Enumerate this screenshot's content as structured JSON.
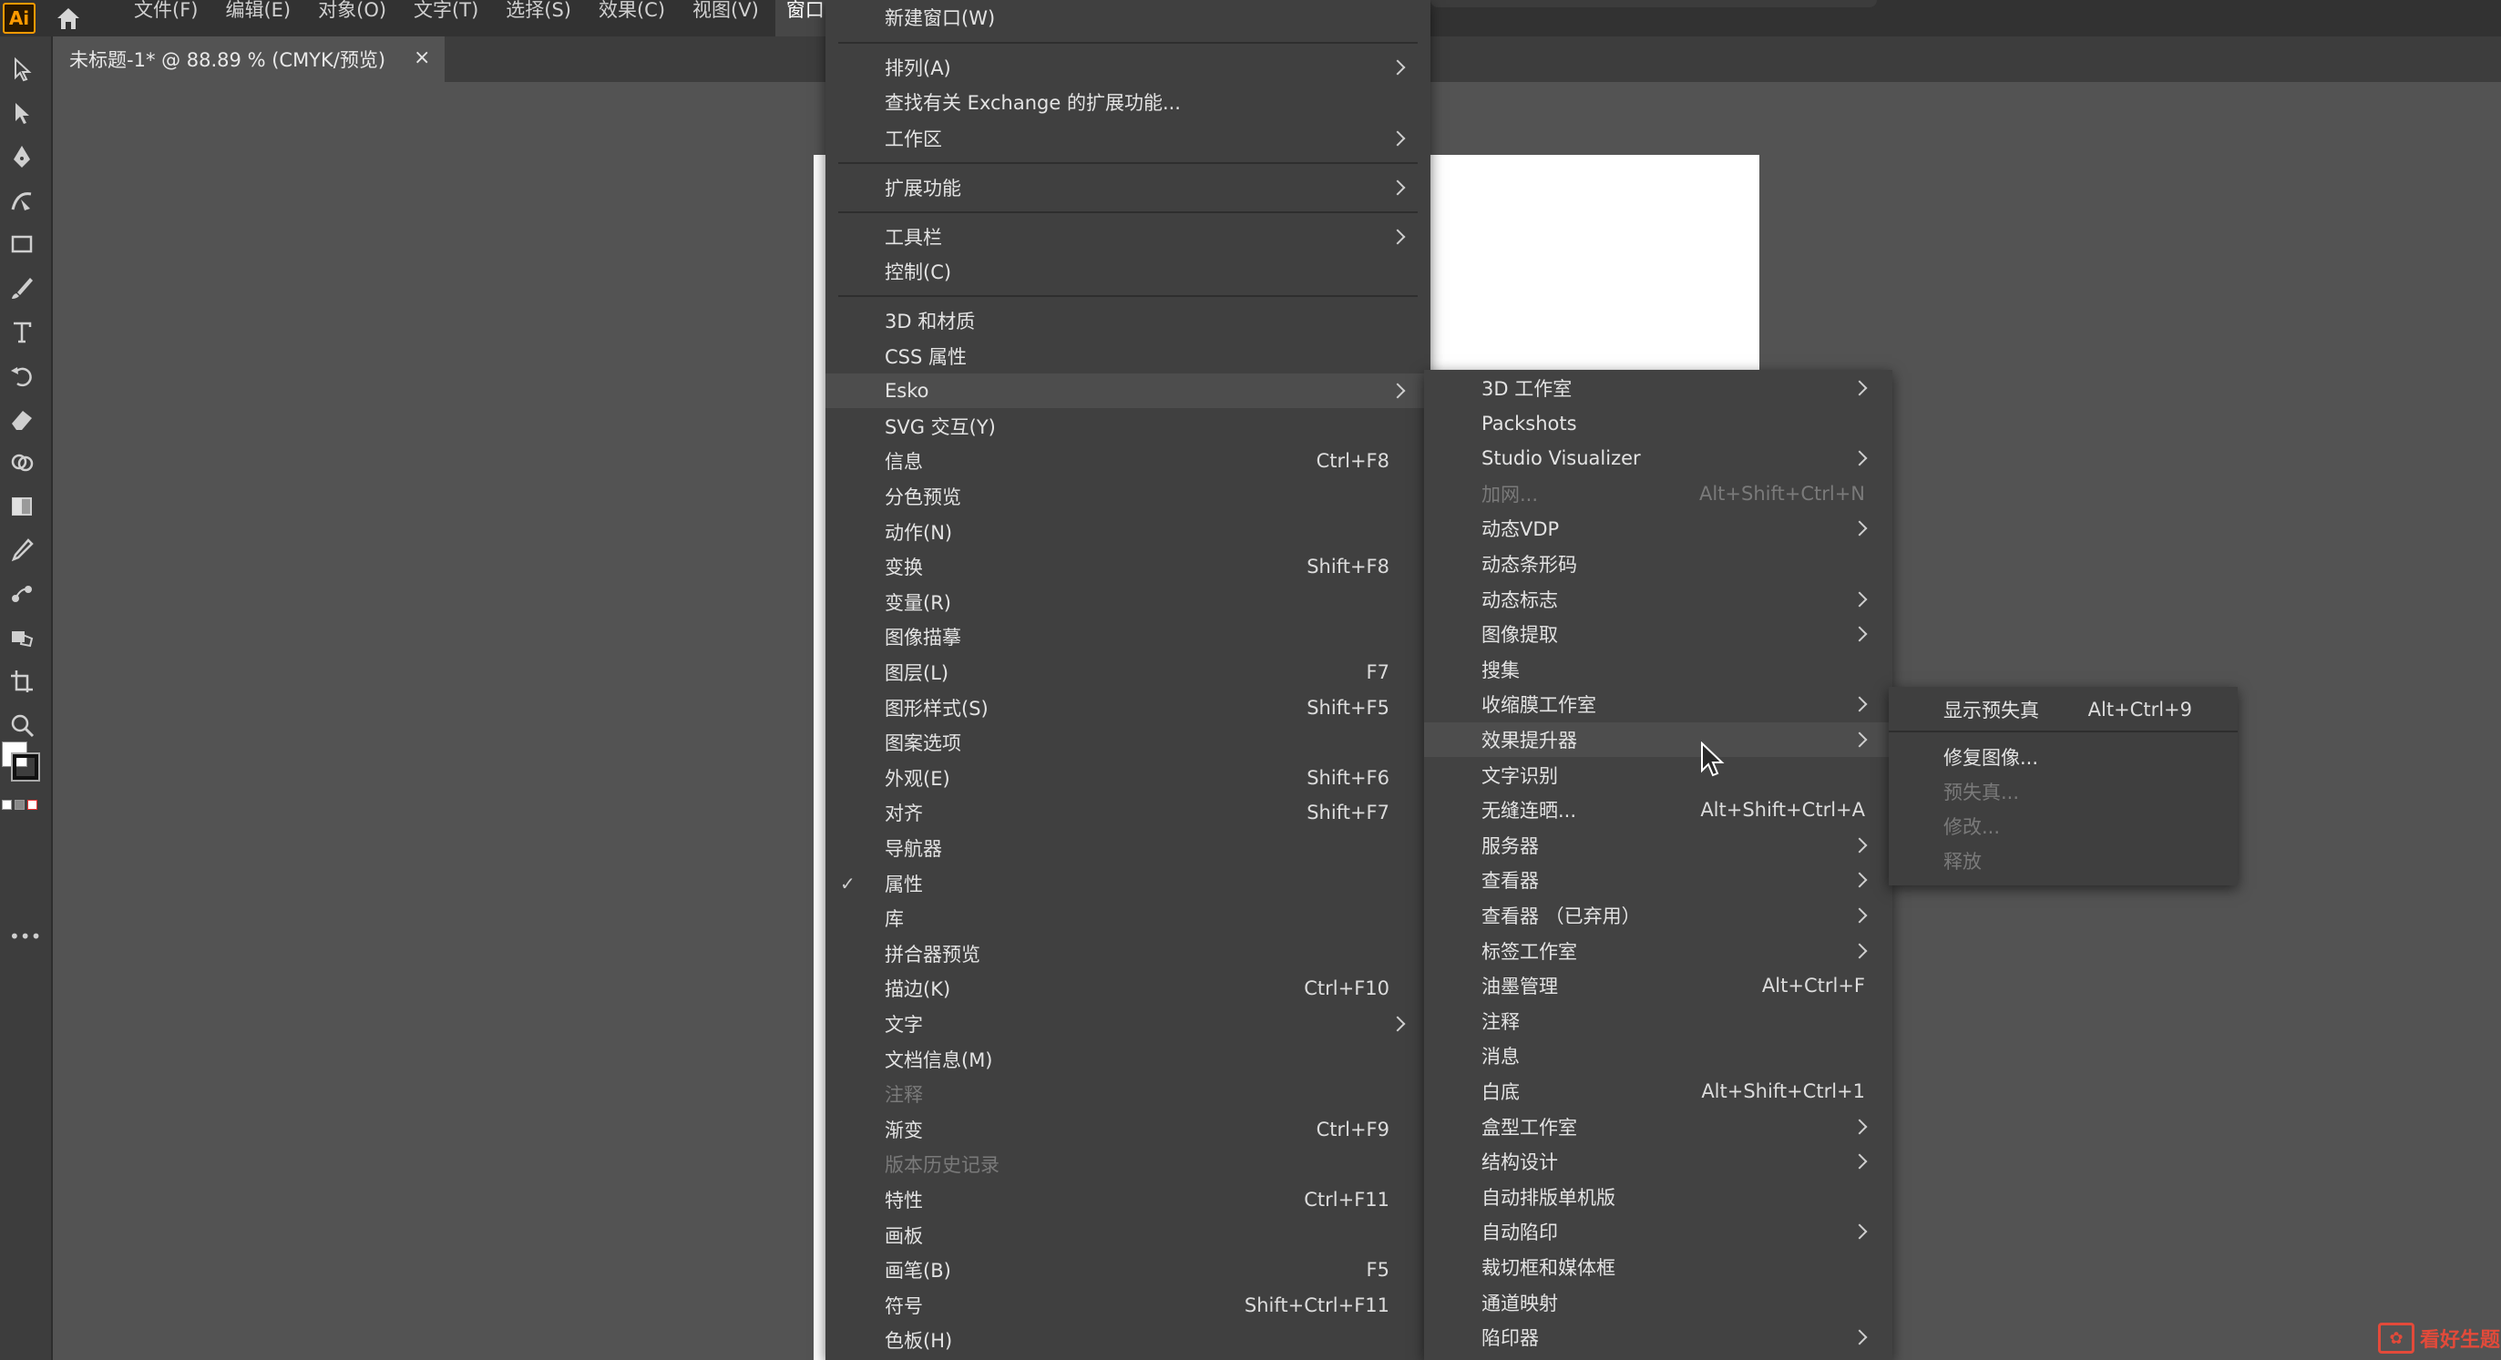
{
  "app": {
    "logo": "Ai",
    "home_icon": "home-icon"
  },
  "menubar": {
    "items": [
      "文件(F)",
      "编辑(E)",
      "对象(O)",
      "文字(T)",
      "选择(S)",
      "效果(C)",
      "视图(V)",
      "窗口(W)"
    ],
    "active_index": 7
  },
  "document_tab": {
    "title": "未标题-1* @ 88.89 % (CMYK/预览)",
    "close": "×"
  },
  "tools": [
    "selection-tool-icon",
    "direct-selection-tool-icon",
    "pen-tool-icon",
    "curvature-tool-icon",
    "rectangle-tool-icon",
    "paintbrush-tool-icon",
    "type-tool-icon",
    "rotate-tool-icon",
    "eraser-tool-icon",
    "shape-builder-tool-icon",
    "gradient-tool-icon",
    "eyedropper-tool-icon",
    "blend-tool-icon",
    "live-paint-tool-icon",
    "artboard-tool-icon",
    "zoom-tool-icon"
  ],
  "toolbar_more": "•••",
  "window_menu": {
    "items": [
      {
        "label": "新建窗口(W)",
        "shortcut": "",
        "submenu": false,
        "disabled": false
      },
      {
        "label": "排列(A)",
        "shortcut": "",
        "submenu": true,
        "disabled": false
      },
      {
        "label": "查找有关 Exchange 的扩展功能...",
        "shortcut": "",
        "submenu": false,
        "disabled": false
      },
      {
        "label": "工作区",
        "shortcut": "",
        "submenu": true,
        "disabled": false
      },
      {
        "label": "扩展功能",
        "shortcut": "",
        "submenu": true,
        "disabled": false
      },
      {
        "label": "工具栏",
        "shortcut": "",
        "submenu": true,
        "disabled": false
      },
      {
        "label": "控制(C)",
        "shortcut": "",
        "submenu": false,
        "disabled": false
      },
      {
        "label": "3D 和材质",
        "shortcut": "",
        "submenu": false,
        "disabled": false
      },
      {
        "label": "CSS 属性",
        "shortcut": "",
        "submenu": false,
        "disabled": false
      },
      {
        "label": "Esko",
        "shortcut": "",
        "submenu": true,
        "disabled": false,
        "highlighted": true
      },
      {
        "label": "SVG 交互(Y)",
        "shortcut": "",
        "submenu": false,
        "disabled": false
      },
      {
        "label": "信息",
        "shortcut": "Ctrl+F8",
        "submenu": false,
        "disabled": false
      },
      {
        "label": "分色预览",
        "shortcut": "",
        "submenu": false,
        "disabled": false
      },
      {
        "label": "动作(N)",
        "shortcut": "",
        "submenu": false,
        "disabled": false
      },
      {
        "label": "变换",
        "shortcut": "Shift+F8",
        "submenu": false,
        "disabled": false
      },
      {
        "label": "变量(R)",
        "shortcut": "",
        "submenu": false,
        "disabled": false
      },
      {
        "label": "图像描摹",
        "shortcut": "",
        "submenu": false,
        "disabled": false
      },
      {
        "label": "图层(L)",
        "shortcut": "F7",
        "submenu": false,
        "disabled": false
      },
      {
        "label": "图形样式(S)",
        "shortcut": "Shift+F5",
        "submenu": false,
        "disabled": false
      },
      {
        "label": "图案选项",
        "shortcut": "",
        "submenu": false,
        "disabled": false
      },
      {
        "label": "外观(E)",
        "shortcut": "Shift+F6",
        "submenu": false,
        "disabled": false
      },
      {
        "label": "对齐",
        "shortcut": "Shift+F7",
        "submenu": false,
        "disabled": false
      },
      {
        "label": "导航器",
        "shortcut": "",
        "submenu": false,
        "disabled": false
      },
      {
        "label": "属性",
        "shortcut": "",
        "submenu": false,
        "disabled": false,
        "checked": true
      },
      {
        "label": "库",
        "shortcut": "",
        "submenu": false,
        "disabled": false
      },
      {
        "label": "拼合器预览",
        "shortcut": "",
        "submenu": false,
        "disabled": false
      },
      {
        "label": "描边(K)",
        "shortcut": "Ctrl+F10",
        "submenu": false,
        "disabled": false
      },
      {
        "label": "文字",
        "shortcut": "",
        "submenu": true,
        "disabled": false
      },
      {
        "label": "文档信息(M)",
        "shortcut": "",
        "submenu": false,
        "disabled": false
      },
      {
        "label": "注释",
        "shortcut": "",
        "submenu": false,
        "disabled": true
      },
      {
        "label": "渐变",
        "shortcut": "Ctrl+F9",
        "submenu": false,
        "disabled": false
      },
      {
        "label": "版本历史记录",
        "shortcut": "",
        "submenu": false,
        "disabled": true
      },
      {
        "label": "特性",
        "shortcut": "Ctrl+F11",
        "submenu": false,
        "disabled": false
      },
      {
        "label": "画板",
        "shortcut": "",
        "submenu": false,
        "disabled": false
      },
      {
        "label": "画笔(B)",
        "shortcut": "F5",
        "submenu": false,
        "disabled": false
      },
      {
        "label": "符号",
        "shortcut": "Shift+Ctrl+F11",
        "submenu": false,
        "disabled": false
      },
      {
        "label": "色板(H)",
        "shortcut": "",
        "submenu": false,
        "disabled": false
      }
    ]
  },
  "esko_menu": {
    "items": [
      {
        "label": "3D 工作室",
        "shortcut": "",
        "submenu": true,
        "disabled": false
      },
      {
        "label": "Packshots",
        "shortcut": "",
        "submenu": false,
        "disabled": false
      },
      {
        "label": "Studio Visualizer",
        "shortcut": "",
        "submenu": true,
        "disabled": false
      },
      {
        "label": "加网...",
        "shortcut": "Alt+Shift+Ctrl+N",
        "submenu": false,
        "disabled": true
      },
      {
        "label": "动态VDP",
        "shortcut": "",
        "submenu": true,
        "disabled": false
      },
      {
        "label": "动态条形码",
        "shortcut": "",
        "submenu": false,
        "disabled": false
      },
      {
        "label": "动态标志",
        "shortcut": "",
        "submenu": true,
        "disabled": false
      },
      {
        "label": "图像提取",
        "shortcut": "",
        "submenu": true,
        "disabled": false
      },
      {
        "label": "搜集",
        "shortcut": "",
        "submenu": false,
        "disabled": false
      },
      {
        "label": "收缩膜工作室",
        "shortcut": "",
        "submenu": true,
        "disabled": false
      },
      {
        "label": "效果提升器",
        "shortcut": "",
        "submenu": true,
        "disabled": false,
        "highlighted": true
      },
      {
        "label": "文字识别",
        "shortcut": "",
        "submenu": false,
        "disabled": false
      },
      {
        "label": "无缝连晒...",
        "shortcut": "Alt+Shift+Ctrl+A",
        "submenu": false,
        "disabled": false
      },
      {
        "label": "服务器",
        "shortcut": "",
        "submenu": true,
        "disabled": false
      },
      {
        "label": "查看器",
        "shortcut": "",
        "submenu": true,
        "disabled": false
      },
      {
        "label": "查看器 （已弃用）",
        "shortcut": "",
        "submenu": true,
        "disabled": false
      },
      {
        "label": "标签工作室",
        "shortcut": "",
        "submenu": true,
        "disabled": false
      },
      {
        "label": "油墨管理",
        "shortcut": "Alt+Ctrl+F",
        "submenu": false,
        "disabled": false
      },
      {
        "label": "注释",
        "shortcut": "",
        "submenu": false,
        "disabled": false
      },
      {
        "label": "消息",
        "shortcut": "",
        "submenu": false,
        "disabled": false
      },
      {
        "label": "白底",
        "shortcut": "Alt+Shift+Ctrl+1",
        "submenu": false,
        "disabled": false
      },
      {
        "label": "盒型工作室",
        "shortcut": "",
        "submenu": true,
        "disabled": false
      },
      {
        "label": "结构设计",
        "shortcut": "",
        "submenu": true,
        "disabled": false
      },
      {
        "label": "自动排版单机版",
        "shortcut": "",
        "submenu": false,
        "disabled": false
      },
      {
        "label": "自动陷印",
        "shortcut": "",
        "submenu": true,
        "disabled": false
      },
      {
        "label": "裁切框和媒体框",
        "shortcut": "",
        "submenu": false,
        "disabled": false
      },
      {
        "label": "通道映射",
        "shortcut": "",
        "submenu": false,
        "disabled": false
      },
      {
        "label": "陷印器",
        "shortcut": "",
        "submenu": true,
        "disabled": false
      }
    ]
  },
  "effect_menu": {
    "items": [
      {
        "label": "显示预失真",
        "shortcut": "Alt+Ctrl+9",
        "disabled": false
      },
      {
        "label": "修复图像...",
        "shortcut": "",
        "disabled": false
      },
      {
        "label": "预失真...",
        "shortcut": "",
        "disabled": true
      },
      {
        "label": "修改...",
        "shortcut": "",
        "disabled": true
      },
      {
        "label": "释放",
        "shortcut": "",
        "disabled": true
      }
    ]
  },
  "watermark": {
    "text": "看好生题"
  }
}
